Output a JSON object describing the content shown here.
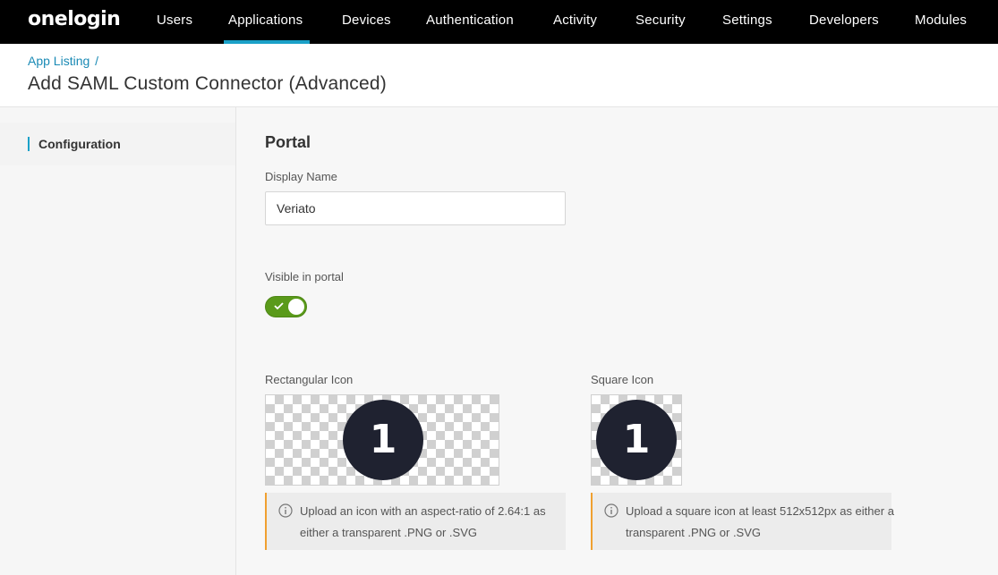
{
  "app": {
    "logo": "onelogin"
  },
  "nav": {
    "items": [
      {
        "label": "Users"
      },
      {
        "label": "Applications"
      },
      {
        "label": "Devices"
      },
      {
        "label": "Authentication"
      },
      {
        "label": "Activity"
      },
      {
        "label": "Security"
      },
      {
        "label": "Settings"
      },
      {
        "label": "Developers"
      },
      {
        "label": "Modules"
      }
    ],
    "active": "Applications"
  },
  "header": {
    "breadcrumb": "App Listing",
    "breadcrumb_sep": "/",
    "title": "Add SAML Custom Connector (Advanced)"
  },
  "sidebar": {
    "items": [
      {
        "label": "Configuration"
      }
    ]
  },
  "portal": {
    "section_title": "Portal",
    "display_name_label": "Display Name",
    "display_name_value": "Veriato",
    "visible_label": "Visible in portal",
    "visible_on": true,
    "rect_icon_label": "Rectangular Icon",
    "square_icon_label": "Square Icon",
    "icon_glyph": "1",
    "rect_info": "Upload an icon with an aspect-ratio of 2.64:1 as either a transparent .PNG or .SVG",
    "square_info": "Upload a square icon at least 512x512px as either a transparent .PNG or .SVG"
  },
  "colors": {
    "nav_bg": "#000000",
    "accent": "#1aa1c8",
    "toggle_on": "#5a9a1a",
    "info_border": "#f0a030",
    "logo_bg": "#1f2230"
  },
  "icons": [
    "info-icon",
    "check-icon"
  ]
}
